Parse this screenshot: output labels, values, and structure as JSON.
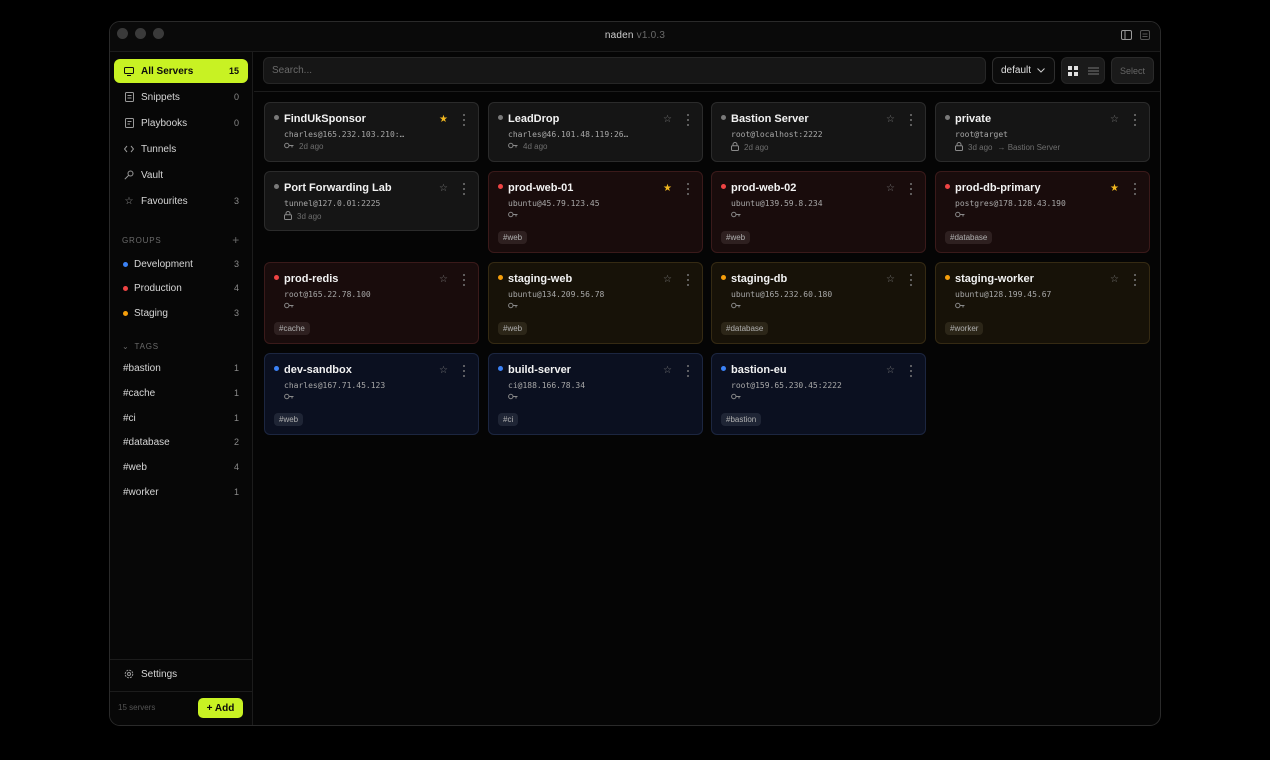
{
  "app": {
    "name": "naden",
    "version": "v1.0.3"
  },
  "sidebar": {
    "nav": [
      {
        "label": "All Servers",
        "icon": "monitor-icon",
        "count": "15",
        "active": true
      },
      {
        "label": "Snippets",
        "icon": "document-icon",
        "count": "0"
      },
      {
        "label": "Playbooks",
        "icon": "book-icon",
        "count": "0"
      },
      {
        "label": "Tunnels",
        "icon": "arrows-icon",
        "count": ""
      },
      {
        "label": "Vault",
        "icon": "key-icon",
        "count": ""
      },
      {
        "label": "Favourites",
        "icon": "star-icon",
        "count": "3"
      }
    ],
    "groups_label": "GROUPS",
    "groups": [
      {
        "label": "Development",
        "count": "3",
        "color": "#3b82f6"
      },
      {
        "label": "Production",
        "count": "4",
        "color": "#ef4444"
      },
      {
        "label": "Staging",
        "count": "3",
        "color": "#f59e0b"
      }
    ],
    "tags_label": "TAGS",
    "tags": [
      {
        "label": "#bastion",
        "count": "1"
      },
      {
        "label": "#cache",
        "count": "1"
      },
      {
        "label": "#ci",
        "count": "1"
      },
      {
        "label": "#database",
        "count": "2"
      },
      {
        "label": "#web",
        "count": "4"
      },
      {
        "label": "#worker",
        "count": "1"
      }
    ],
    "settings_label": "Settings",
    "server_count": "15 servers",
    "add_label": "+ Add"
  },
  "toolbar": {
    "search_placeholder": "Search...",
    "sort_value": "default",
    "select_label": "Select"
  },
  "accent": "#c8f223",
  "servers": [
    {
      "name": "FindUkSponsor",
      "addr": "charles@165.232.103.210:…",
      "meta": "2d ago",
      "meta_icon": "key-icon",
      "fav": true,
      "group": "none",
      "tag": ""
    },
    {
      "name": "LeadDrop",
      "addr": "charles@46.101.48.119:26…",
      "meta": "4d ago",
      "meta_icon": "key-icon",
      "fav": false,
      "group": "none",
      "tag": ""
    },
    {
      "name": "Bastion Server",
      "addr": "root@localhost:2222",
      "meta": "2d ago",
      "meta_icon": "lock-icon",
      "fav": false,
      "group": "none",
      "tag": ""
    },
    {
      "name": "private",
      "addr": "root@target",
      "meta": "3d ago",
      "meta_extra": "→ Bastion Server",
      "meta_icon": "lock-icon",
      "fav": false,
      "group": "none",
      "tag": ""
    },
    {
      "name": "Port Forwarding Lab",
      "addr": "tunnel@127.0.01:2225",
      "meta": "3d ago",
      "meta_icon": "lock-icon",
      "fav": false,
      "group": "none",
      "tag": ""
    },
    {
      "name": "prod-web-01",
      "addr": "ubuntu@45.79.123.45",
      "meta": "",
      "meta_icon": "key-icon",
      "fav": true,
      "group": "prod",
      "tag": "#web"
    },
    {
      "name": "prod-web-02",
      "addr": "ubuntu@139.59.8.234",
      "meta": "",
      "meta_icon": "key-icon",
      "fav": false,
      "group": "prod",
      "tag": "#web"
    },
    {
      "name": "prod-db-primary",
      "addr": "postgres@178.128.43.190",
      "meta": "",
      "meta_icon": "key-icon",
      "fav": true,
      "group": "prod",
      "tag": "#database"
    },
    {
      "name": "prod-redis",
      "addr": "root@165.22.78.100",
      "meta": "",
      "meta_icon": "key-icon",
      "fav": false,
      "group": "prod",
      "tag": "#cache"
    },
    {
      "name": "staging-web",
      "addr": "ubuntu@134.209.56.78",
      "meta": "",
      "meta_icon": "key-icon",
      "fav": false,
      "group": "stage",
      "tag": "#web"
    },
    {
      "name": "staging-db",
      "addr": "ubuntu@165.232.60.180",
      "meta": "",
      "meta_icon": "key-icon",
      "fav": false,
      "group": "stage",
      "tag": "#database"
    },
    {
      "name": "staging-worker",
      "addr": "ubuntu@128.199.45.67",
      "meta": "",
      "meta_icon": "key-icon",
      "fav": false,
      "group": "stage",
      "tag": "#worker"
    },
    {
      "name": "dev-sandbox",
      "addr": "charles@167.71.45.123",
      "meta": "",
      "meta_icon": "key-icon",
      "fav": false,
      "group": "dev",
      "tag": "#web"
    },
    {
      "name": "build-server",
      "addr": "ci@188.166.78.34",
      "meta": "",
      "meta_icon": "key-icon",
      "fav": false,
      "group": "dev",
      "tag": "#ci"
    },
    {
      "name": "bastion-eu",
      "addr": "root@159.65.230.45:2222",
      "meta": "",
      "meta_icon": "key-icon",
      "fav": false,
      "group": "dev",
      "tag": "#bastion"
    }
  ]
}
